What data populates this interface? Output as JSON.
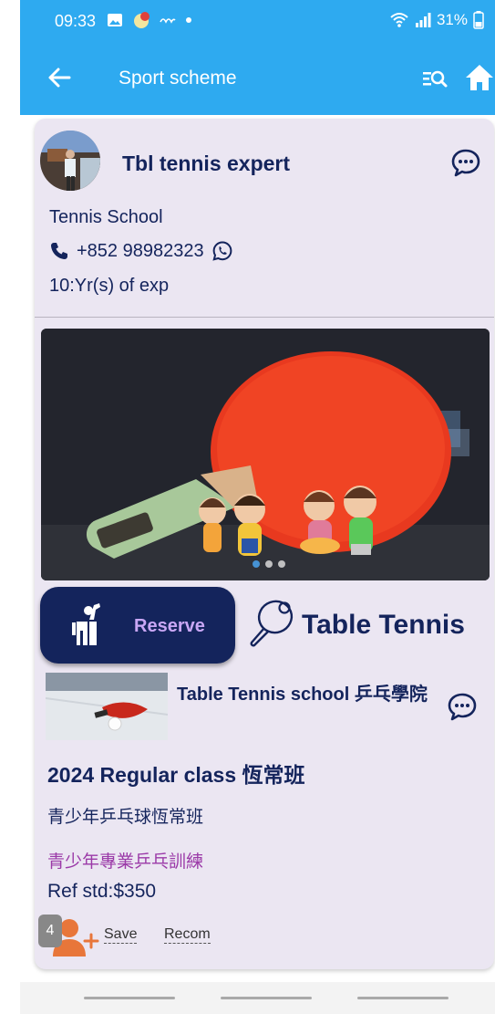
{
  "status_bar": {
    "time": "09:33",
    "icons": [
      "image-icon",
      "app-notification-icon",
      "voicemail-icon",
      "dot-icon"
    ],
    "wifi_icon": "wifi-icon",
    "signal_icon": "signal-icon",
    "battery": "31%",
    "battery_icon": "battery-icon"
  },
  "app_bar": {
    "title": "Sport scheme",
    "back_icon": "arrow-left-icon",
    "search_icon": "list-search-icon",
    "home_icon": "home-icon",
    "color": "#2eaaf0"
  },
  "coach": {
    "name": "Tbl tennis expert",
    "school": "Tennis School",
    "phone": "+852 98982323",
    "experience": "10:Yr(s) of exp"
  },
  "carousel": {
    "total": 3,
    "active": 0
  },
  "reserve": {
    "label": "Reserve"
  },
  "sport": {
    "name": "Table Tennis"
  },
  "school": {
    "name": "Table Tennis school 乒乓學院"
  },
  "class_info": {
    "title": "2024 Regular class 恆常班",
    "subtitle": "青少年乒乓球恆常班",
    "description": "青少年專業乒乓訓練",
    "ref_price": "Ref std:$350"
  },
  "actions": {
    "count": "4",
    "save_label": "Save",
    "recom_label": "Recom"
  },
  "colors": {
    "primary_navy": "#14245c",
    "description_purple": "#9b3aa8",
    "reserve_text": "#c9a7f5",
    "person_add_orange": "#e8763a"
  }
}
